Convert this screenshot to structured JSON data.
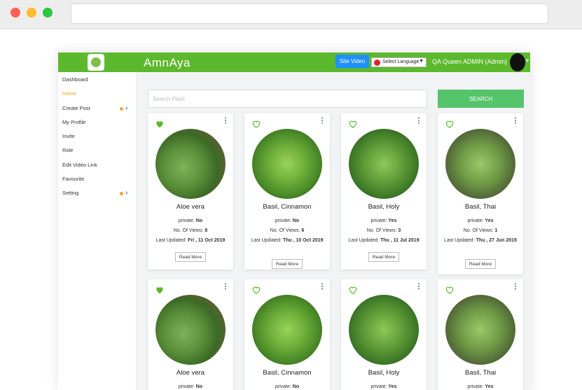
{
  "app": {
    "brand": "AmnAya",
    "site_video_label": "Site Video",
    "language_label": "Select Language",
    "user_label": "QA Queen ADMIN (Admin)"
  },
  "sidebar": {
    "items": [
      {
        "label": "Dashboard"
      },
      {
        "label": "Home"
      },
      {
        "label": "Create Post"
      },
      {
        "label": "My Profile"
      },
      {
        "label": "Invite"
      },
      {
        "label": "Role"
      },
      {
        "label": "Edit Video Link"
      },
      {
        "label": "Favourite"
      },
      {
        "label": "Setting"
      }
    ]
  },
  "search": {
    "placeholder": "Search Plant",
    "button_label": "SEARCH"
  },
  "labels": {
    "private": "private:",
    "views": "No. Of Views:",
    "updated": "Last Updated:",
    "read_more": "Read More"
  },
  "colors": {
    "accent": "#5cb82c",
    "search_button": "#55c46a",
    "active_sidebar": "#f4a32a",
    "site_video": "#1e90ff"
  },
  "cards": [
    {
      "name": "Aloe vera",
      "private": "No",
      "views": "8",
      "updated": "Fri , 11 Oct 2019",
      "favourite": true
    },
    {
      "name": "Basil, Cinnamon",
      "private": "No",
      "views": "6",
      "updated": "Thu , 10 Oct 2019",
      "favourite": false
    },
    {
      "name": "Basil, Holy",
      "private": "Yes",
      "views": "3",
      "updated": "Thu , 11 Jul 2019",
      "favourite": false
    },
    {
      "name": "Basil, Thai",
      "private": "Yes",
      "views": "1",
      "updated": "Thu , 27 Jun 2019",
      "favourite": false
    },
    {
      "name": "Aloe vera",
      "private": "No",
      "favourite": true
    },
    {
      "name": "Basil, Cinnamon",
      "private": "No",
      "favourite": false
    },
    {
      "name": "Basil, Holy",
      "private": "Yes",
      "favourite": false
    },
    {
      "name": "Basil, Thai",
      "private": "Yes",
      "favourite": false
    }
  ]
}
